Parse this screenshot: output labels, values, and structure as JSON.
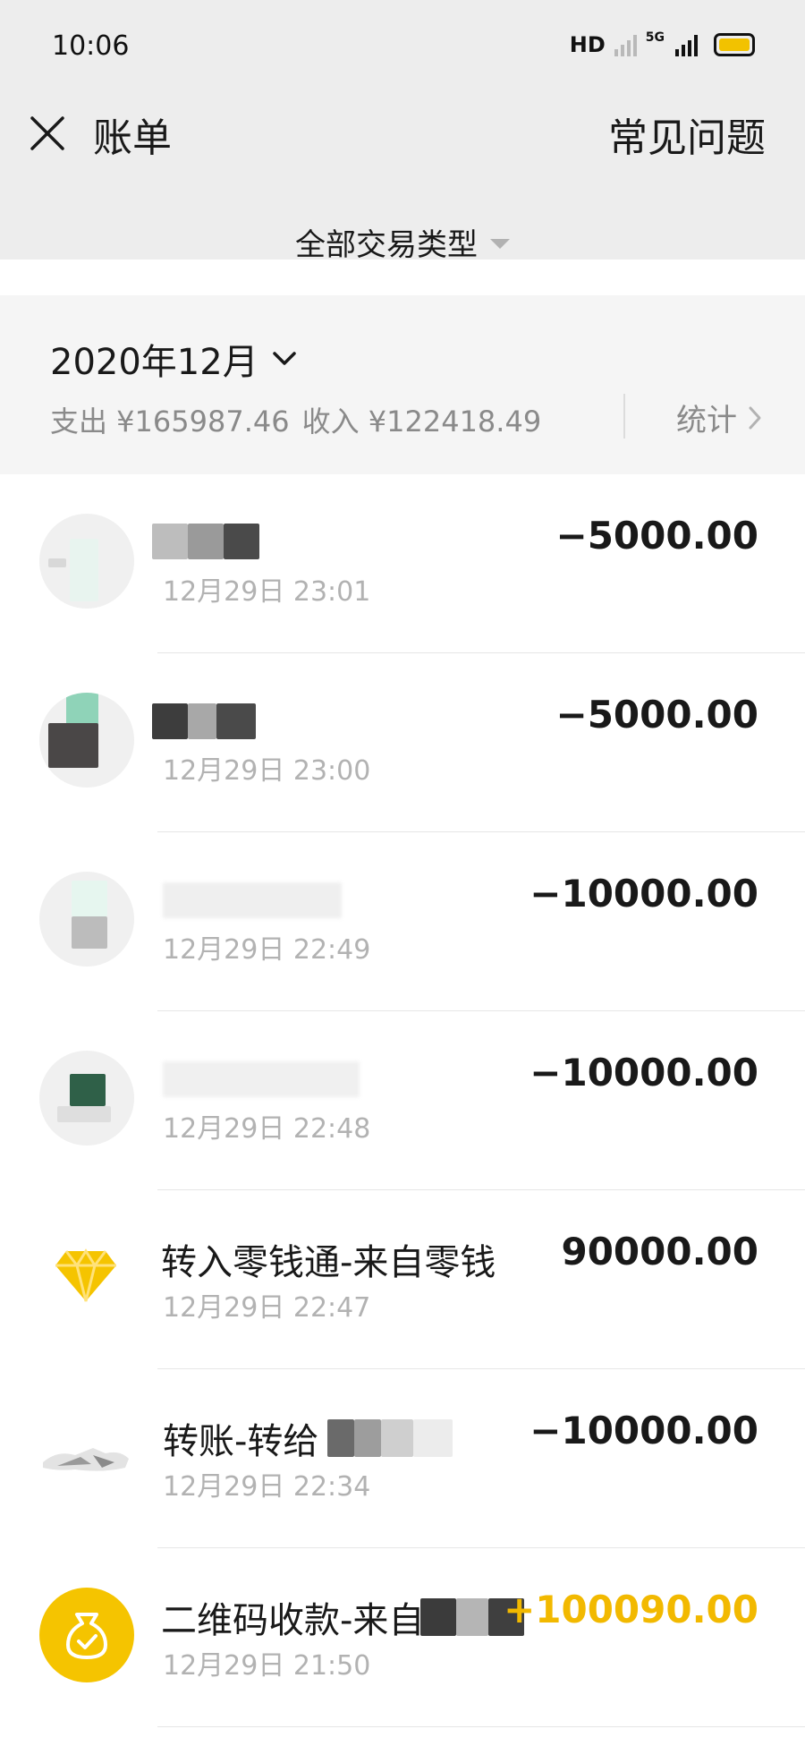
{
  "status_bar": {
    "time": "10:06",
    "hd_label": "HD",
    "network_label": "5G",
    "battery_color": "#f2c200"
  },
  "nav": {
    "title": "账单",
    "faq_label": "常见问题",
    "filter_label": "全部交易类型",
    "close_icon": "close-icon"
  },
  "summary": {
    "month": "2020年12月",
    "expense_label": "支出 ¥165987.46",
    "income_label": "收入 ¥122418.49",
    "stats_label": "统计"
  },
  "transactions": [
    {
      "name": "",
      "time": "12月29日 23:01",
      "amount": "−5000.00",
      "type": "expense",
      "icon": "bank-logo-icon"
    },
    {
      "name": "",
      "time": "12月29日 23:00",
      "amount": "−5000.00",
      "type": "expense",
      "icon": "bank-logo-icon"
    },
    {
      "name": "",
      "time": "12月29日 22:49",
      "amount": "−10000.00",
      "type": "expense",
      "icon": "bank-logo-icon"
    },
    {
      "name": "",
      "time": "12月29日 22:48",
      "amount": "−10000.00",
      "type": "expense",
      "icon": "bank-logo-icon"
    },
    {
      "name": "转入零钱通-来自零钱",
      "time": "12月29日 22:47",
      "amount": "90000.00",
      "type": "transfer",
      "icon": "diamond-icon"
    },
    {
      "name": "转账-转给",
      "time": "12月29日 22:34",
      "amount": "−10000.00",
      "type": "expense",
      "icon": "avatar-photo-icon"
    },
    {
      "name": "二维码收款-来自",
      "time": "12月29日 21:50",
      "amount": "+100090.00",
      "type": "income",
      "icon": "money-bag-icon"
    }
  ],
  "colors": {
    "income": "#f2b900",
    "header_bg": "#ededed",
    "summary_bg": "#f5f5f5",
    "diamond": "#f5c400"
  }
}
